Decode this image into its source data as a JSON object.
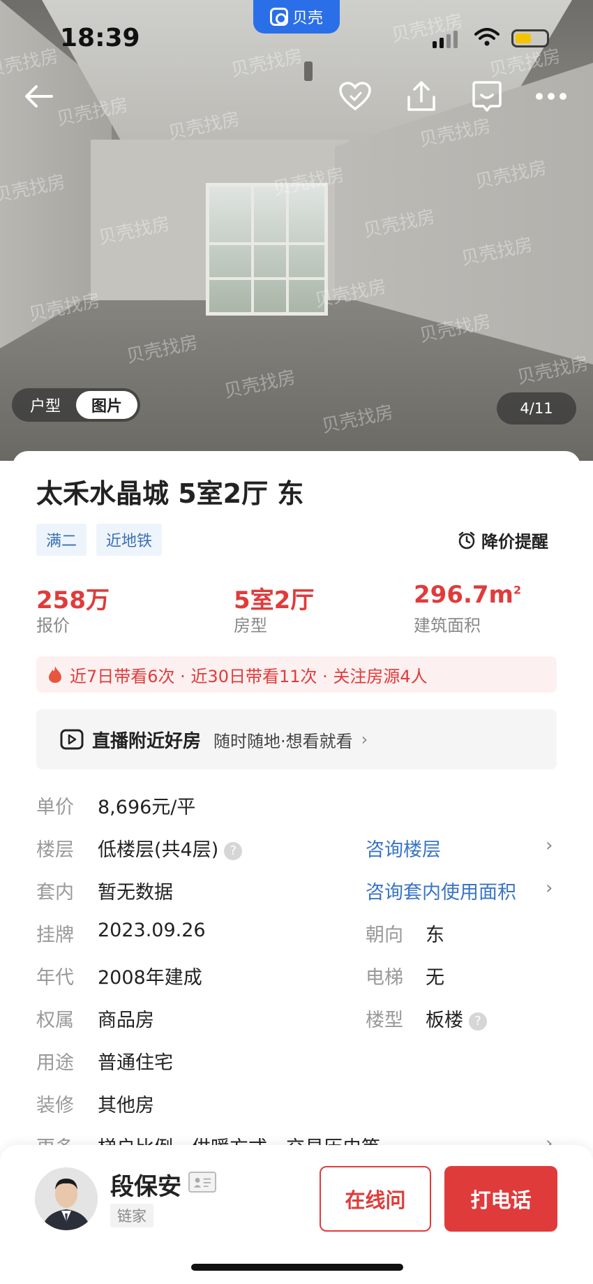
{
  "status_bar": {
    "time": "18:39",
    "app_pill": "贝壳"
  },
  "photo": {
    "watermark": "贝壳找房",
    "tabs": [
      {
        "label": "户型",
        "active": false
      },
      {
        "label": "图片",
        "active": true
      }
    ],
    "counter": "4/11"
  },
  "nav": {
    "icons": [
      "back-icon",
      "heart-icon",
      "share-icon",
      "message-icon",
      "more-icon"
    ]
  },
  "listing": {
    "title": "太禾水晶城 5室2厅 东",
    "tags": [
      "满二",
      "近地铁"
    ],
    "price_alert": "降价提醒",
    "stats": [
      {
        "value": "258万",
        "label": "报价"
      },
      {
        "value": "5室2厅",
        "label": "房型"
      },
      {
        "value": "296.7m",
        "sup": "2",
        "label": "建筑面积"
      }
    ],
    "heat": "近7日带看6次 · 近30日带看11次 · 关注房源4人",
    "live": {
      "title": "直播附近好房",
      "subtitle": "随时随地·想看就看"
    },
    "details": {
      "unit_price": {
        "label": "单价",
        "value": "8,696元/平"
      },
      "floor": {
        "label": "楼层",
        "value": "低楼层(共4层)",
        "link": "咨询楼层"
      },
      "inner": {
        "label": "套内",
        "value": "暂无数据",
        "link": "咨询套内使用面积"
      },
      "listed": {
        "label": "挂牌",
        "value": "2023.09.26"
      },
      "orientation": {
        "label": "朝向",
        "value": "东"
      },
      "year": {
        "label": "年代",
        "value": "2008年建成"
      },
      "elevator": {
        "label": "电梯",
        "value": "无"
      },
      "ownership": {
        "label": "权属",
        "value": "商品房"
      },
      "building_type": {
        "label": "楼型",
        "value": "板楼"
      },
      "usage": {
        "label": "用途",
        "value": "普通住宅"
      },
      "decoration": {
        "label": "装修",
        "value": "其他房"
      },
      "more": {
        "label": "更多",
        "value": "梯户比例、供暖方式、交易历史等"
      }
    }
  },
  "agent": {
    "name": "段保安",
    "agency": "链家"
  },
  "actions": {
    "online": "在线问",
    "call": "打电话"
  },
  "colors": {
    "accent_red": "#e03b3b",
    "link_blue": "#3a75c4",
    "brand_blue": "#2a6fe8"
  }
}
